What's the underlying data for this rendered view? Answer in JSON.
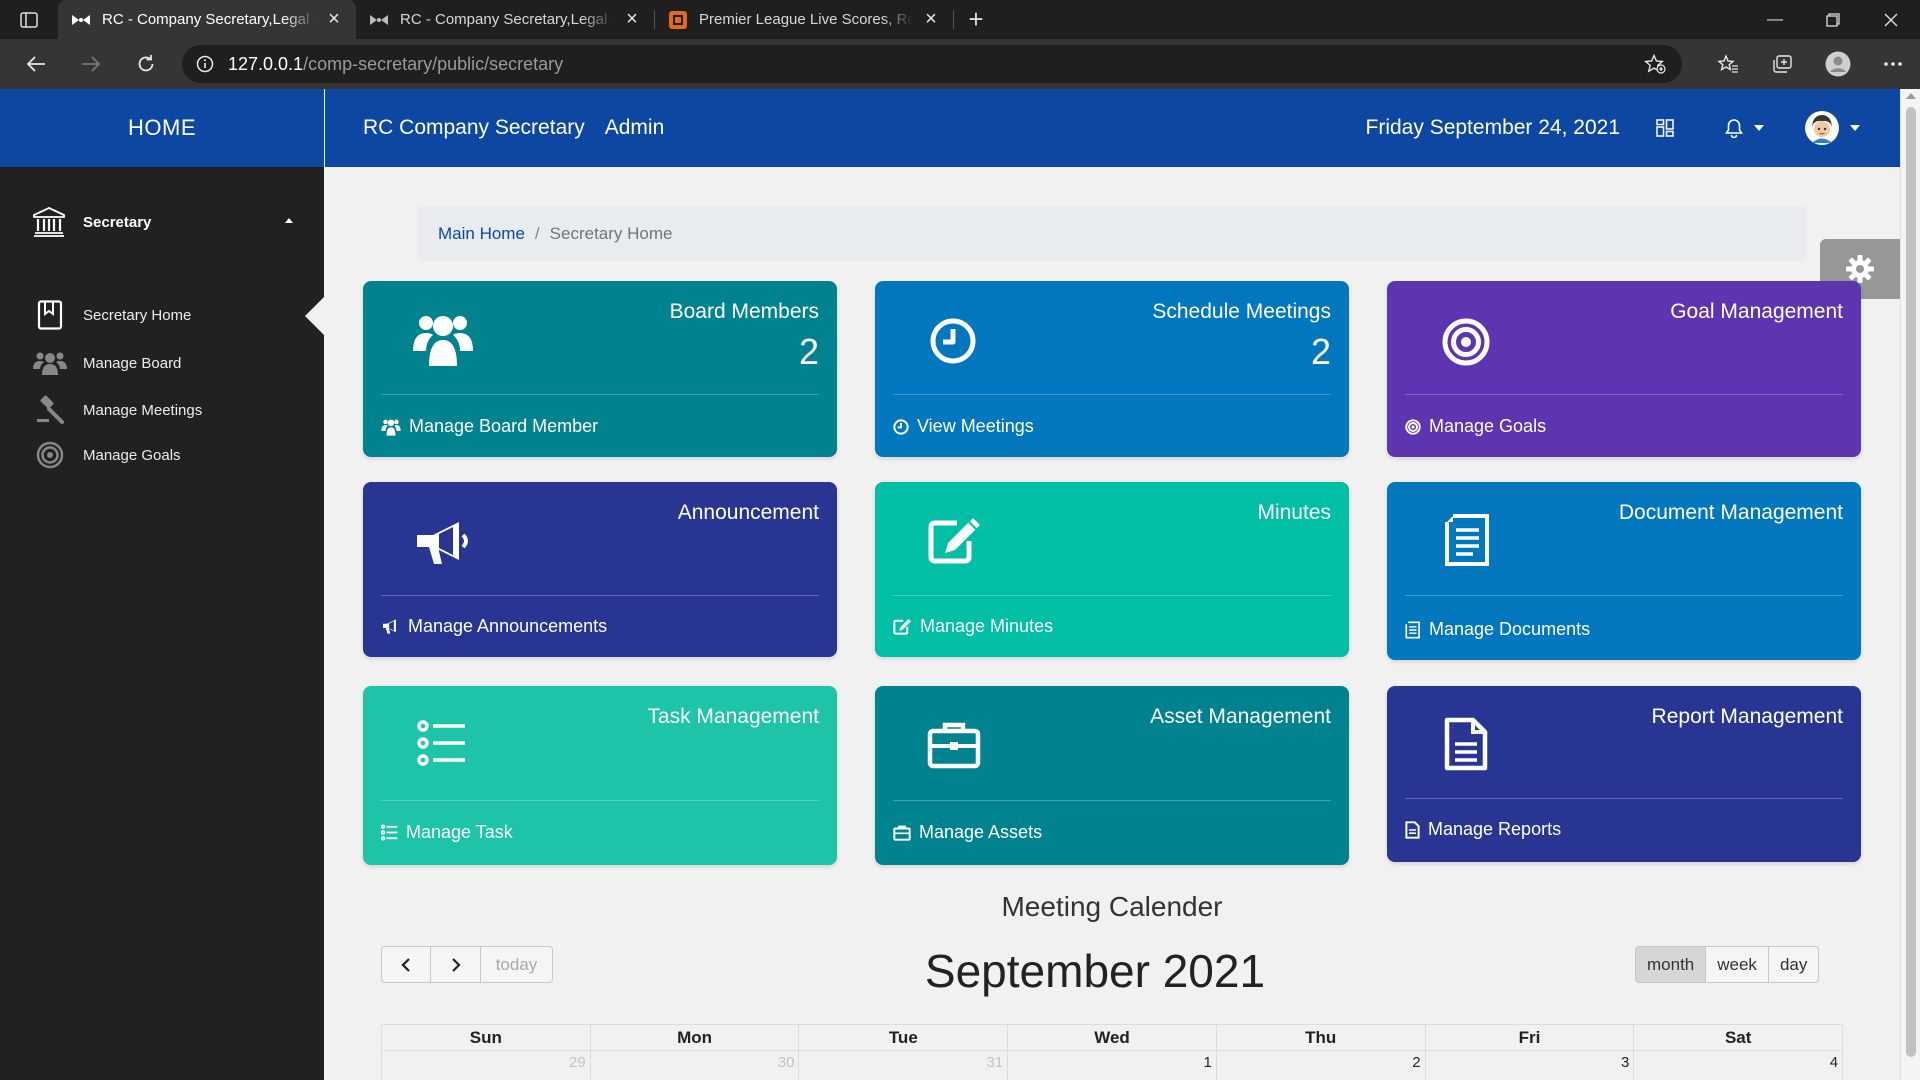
{
  "browser": {
    "tabs": [
      {
        "title": "RC - Company Secretary,Legal & Compliance",
        "active": true
      },
      {
        "title": "RC - Company Secretary,Legal & Compliance",
        "active": false
      },
      {
        "title": "Premier League Live Scores, Results",
        "active": false
      }
    ],
    "url_host": "127.0.0.1",
    "url_path": "/comp-secretary/public/secretary"
  },
  "header": {
    "brand": "HOME",
    "app_title": "RC Company Secretary",
    "role": "Admin",
    "date": "Friday September 24, 2021"
  },
  "sidebar": {
    "section": "Secretary",
    "items": [
      {
        "label": "Secretary Home",
        "icon": "bookmark-book-icon"
      },
      {
        "label": "Manage Board",
        "icon": "users-icon"
      },
      {
        "label": "Manage Meetings",
        "icon": "gavel-icon"
      },
      {
        "label": "Manage Goals",
        "icon": "target-icon"
      }
    ]
  },
  "breadcrumb": {
    "home": "Main Home",
    "separator": "/",
    "current": "Secretary Home"
  },
  "cards": [
    {
      "title": "Board Members",
      "count": "2",
      "link": "Manage Board Member",
      "color": "#00838f",
      "icon": "users-icon"
    },
    {
      "title": "Schedule Meetings",
      "count": "2",
      "link": "View Meetings",
      "color": "#0277bd",
      "icon": "clock-icon"
    },
    {
      "title": "Goal Management",
      "count": "",
      "link": "Manage Goals",
      "color": "#5e35b1",
      "icon": "target-icon"
    },
    {
      "title": "Announcement",
      "count": "",
      "link": "Manage Announcements",
      "color": "#283593",
      "icon": "megaphone-icon"
    },
    {
      "title": "Minutes",
      "count": "",
      "link": "Manage Minutes",
      "color": "#00bfa5",
      "icon": "edit-icon"
    },
    {
      "title": "Document Management",
      "count": "",
      "link": "Manage Documents",
      "color": "#0277bd",
      "icon": "document-icon"
    },
    {
      "title": "Task Management",
      "count": "",
      "link": "Manage Task",
      "color": "#1dc4a7",
      "icon": "list-icon"
    },
    {
      "title": "Asset Management",
      "count": "",
      "link": "Manage Assets",
      "color": "#00838f",
      "icon": "briefcase-icon"
    },
    {
      "title": "Report Management",
      "count": "",
      "link": "Manage Reports",
      "color": "#283593",
      "icon": "file-text-icon"
    }
  ],
  "calendar": {
    "heading": "Meeting Calender",
    "month_title": "September 2021",
    "today_label": "today",
    "views": [
      "month",
      "week",
      "day"
    ],
    "active_view": "month",
    "weekdays": [
      "Sun",
      "Mon",
      "Tue",
      "Wed",
      "Thu",
      "Fri",
      "Sat"
    ],
    "first_row": [
      {
        "day": "29",
        "other": true
      },
      {
        "day": "30",
        "other": true
      },
      {
        "day": "31",
        "other": true
      },
      {
        "day": "1",
        "other": false
      },
      {
        "day": "2",
        "other": false
      },
      {
        "day": "3",
        "other": false
      },
      {
        "day": "4",
        "other": false
      }
    ]
  }
}
